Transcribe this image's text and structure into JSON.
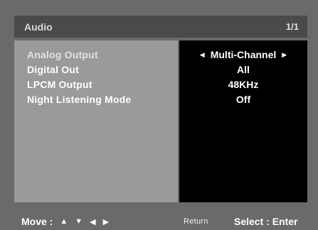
{
  "title": "Audio",
  "page_indicator": "1/1",
  "menu": [
    {
      "label": "Analog Output",
      "value": "Multi-Channel"
    },
    {
      "label": "Digital Out",
      "value": "All"
    },
    {
      "label": "LPCM Output",
      "value": "48KHz"
    },
    {
      "label": "Night Listening Mode",
      "value": "Off"
    }
  ],
  "footer": {
    "move_label": "Move :",
    "return_label": "Return",
    "select_label": "Select : Enter"
  }
}
